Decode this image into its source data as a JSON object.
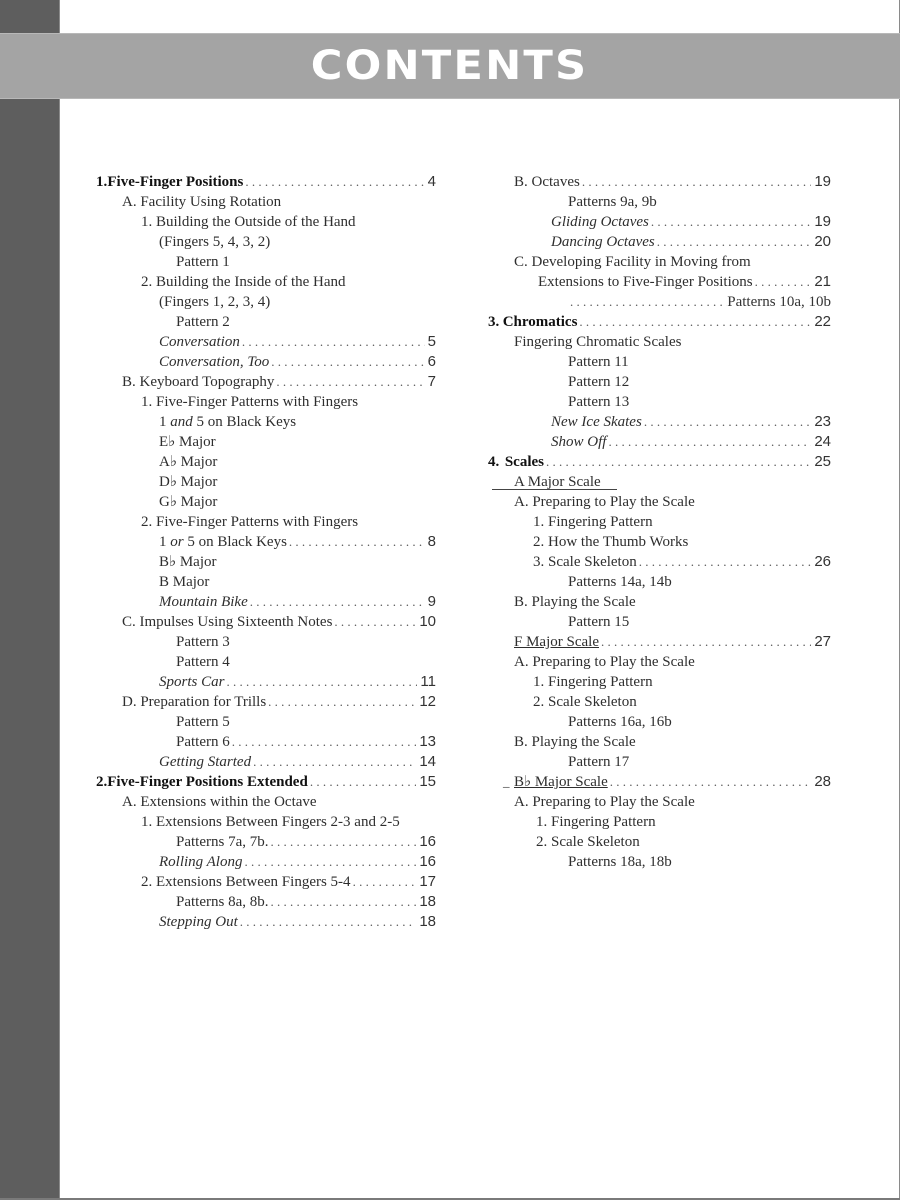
{
  "header": {
    "title": "CONTENTS"
  },
  "left_column": [
    {
      "level": 0,
      "number": "1.",
      "text": "Five-Finger Positions",
      "page": "4",
      "style": "chapter"
    },
    {
      "level": 1,
      "text": "A. Facility Using Rotation"
    },
    {
      "level": 2,
      "text": "1. Building the Outside of the Hand"
    },
    {
      "level": 3,
      "text": "(Fingers 5, 4, 3, 2)"
    },
    {
      "level": 4,
      "text": "Pattern 1"
    },
    {
      "level": 2,
      "text": "2. Building the Inside of the Hand"
    },
    {
      "level": 3,
      "text": "(Fingers 1, 2, 3, 4)"
    },
    {
      "level": 4,
      "text": "Pattern 2"
    },
    {
      "level": 3,
      "text": "Conversation",
      "page": "5",
      "style": "italic"
    },
    {
      "level": 3,
      "text": "Conversation, Too",
      "page": "6",
      "style": "italic"
    },
    {
      "level": 1,
      "text": "B. Keyboard Topography",
      "page": "7"
    },
    {
      "level": 2,
      "text": "1. Five-Finger Patterns with Fingers"
    },
    {
      "level": 3,
      "text_parts": [
        "1 ",
        "and",
        " 5 on Black Keys"
      ]
    },
    {
      "level": 3,
      "text": "E♭ Major"
    },
    {
      "level": 3,
      "text": "A♭ Major"
    },
    {
      "level": 3,
      "text": "D♭ Major"
    },
    {
      "level": 3,
      "text": "G♭ Major"
    },
    {
      "level": 2,
      "text": "2. Five-Finger Patterns with Fingers"
    },
    {
      "level": 3,
      "text_parts": [
        "1 ",
        "or",
        " 5 on Black Keys"
      ],
      "page": "8"
    },
    {
      "level": 3,
      "text": "B♭ Major"
    },
    {
      "level": 3,
      "text": "B Major"
    },
    {
      "level": 3,
      "text": "Mountain Bike",
      "page": "9",
      "style": "italic"
    },
    {
      "level": 1,
      "text": "C. Impulses Using Sixteenth Notes",
      "page": "10"
    },
    {
      "level": 4,
      "text": "Pattern 3"
    },
    {
      "level": 4,
      "text": "Pattern 4"
    },
    {
      "level": 3,
      "text": "Sports Car",
      "page": "11",
      "style": "italic"
    },
    {
      "level": 1,
      "text": "D. Preparation for Trills",
      "page": "12"
    },
    {
      "level": 4,
      "text": "Pattern 5"
    },
    {
      "level": 4,
      "text": "Pattern 6",
      "page": "13"
    },
    {
      "level": 3,
      "text": "Getting Started",
      "page": "14",
      "style": "italic"
    },
    {
      "level": 0,
      "number": "2.",
      "text": "Five-Finger Positions Extended",
      "page": "15",
      "style": "chapter"
    },
    {
      "level": 1,
      "text": "A. Extensions within the Octave"
    },
    {
      "level": 2,
      "text": "1. Extensions Between Fingers 2-3 and 2-5"
    },
    {
      "level": 4,
      "text": "Patterns 7a, 7b.",
      "page": "16"
    },
    {
      "level": 3,
      "text": "Rolling Along",
      "page": "16",
      "style": "italic"
    },
    {
      "level": 2,
      "text": "2. Extensions Between Fingers 5-4",
      "page": "17"
    },
    {
      "level": 4,
      "text": "Patterns 8a, 8b.",
      "page": "18"
    },
    {
      "level": 3,
      "text": "Stepping Out",
      "page": "18",
      "style": "italic"
    }
  ],
  "right_column": [
    {
      "level": 1,
      "text": "B. Octaves",
      "page": "19"
    },
    {
      "level": 4,
      "text": "Patterns 9a, 9b"
    },
    {
      "level": 3,
      "text": "Gliding Octaves",
      "page": "19",
      "style": "italic"
    },
    {
      "level": 3,
      "text": "Dancing Octaves",
      "page": "20",
      "style": "italic"
    },
    {
      "level": 1,
      "text": "C. Developing Facility in Moving from"
    },
    {
      "level": 2.5,
      "text": "Extensions to Five-Finger Positions",
      "page": "21"
    },
    {
      "level": 4,
      "text": "",
      "page": "Patterns 10a, 10b",
      "style": "trailing-serif"
    },
    {
      "level": 0,
      "number": "3.",
      "text": "Chromatics",
      "page": "22",
      "style": "chapter"
    },
    {
      "level": 1,
      "text": "Fingering Chromatic Scales"
    },
    {
      "level": 4,
      "text": "Pattern 11"
    },
    {
      "level": 4,
      "text": "Pattern 12"
    },
    {
      "level": 4,
      "text": "Pattern 13"
    },
    {
      "level": 3,
      "text": "New Ice Skates",
      "page": "23",
      "style": "italic"
    },
    {
      "level": 3,
      "text": "Show Off",
      "page": "24",
      "style": "italic"
    },
    {
      "level": 0,
      "number": "4.",
      "text": "Scales",
      "page": "25",
      "style": "chapter"
    },
    {
      "level": 1,
      "text": "A Major Scale",
      "style": "underline-rule"
    },
    {
      "level": 1,
      "text": "A. Preparing to Play the Scale"
    },
    {
      "level": 2,
      "text": "1. Fingering Pattern"
    },
    {
      "level": 2,
      "text": "2. How the Thumb Works"
    },
    {
      "level": 2,
      "text": "3. Scale Skeleton",
      "page": "26"
    },
    {
      "level": 4,
      "text": "Patterns 14a, 14b"
    },
    {
      "level": 1,
      "text": "B. Playing the Scale"
    },
    {
      "level": 4,
      "text": "Pattern 15"
    },
    {
      "level": 1,
      "text": "F Major Scale",
      "page": "27",
      "style": "underline"
    },
    {
      "level": 1,
      "text": "A. Preparing to Play the Scale"
    },
    {
      "level": 2,
      "text": "1. Fingering Pattern"
    },
    {
      "level": 2,
      "text": "2. Scale Skeleton"
    },
    {
      "level": 4,
      "text": "Patterns 16a, 16b"
    },
    {
      "level": 1,
      "text": "B. Playing the Scale"
    },
    {
      "level": 4,
      "text": "Pattern 17"
    },
    {
      "level": 1,
      "text": "B♭ Major Scale",
      "page": "28",
      "style": "underline-dash"
    },
    {
      "level": 1,
      "text": "A. Preparing to Play the Scale"
    },
    {
      "level": 2.2,
      "text": "1. Fingering Pattern"
    },
    {
      "level": 2.2,
      "text": "2. Scale Skeleton"
    },
    {
      "level": 4,
      "text": "Patterns 18a, 18b"
    }
  ]
}
